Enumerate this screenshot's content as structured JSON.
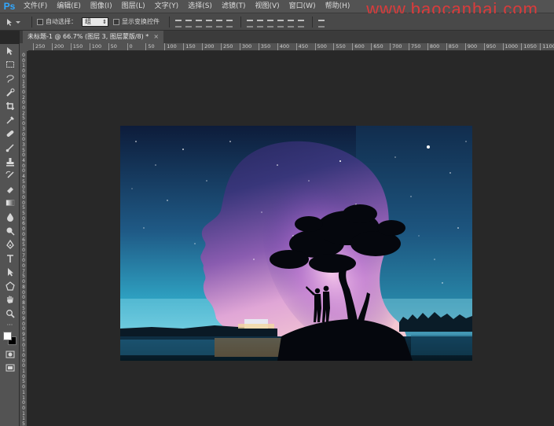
{
  "app": {
    "logo": "Ps"
  },
  "menu": {
    "items": [
      "文件(F)",
      "编辑(E)",
      "图像(I)",
      "图层(L)",
      "文字(Y)",
      "选择(S)",
      "滤镜(T)",
      "视图(V)",
      "窗口(W)",
      "帮助(H)"
    ]
  },
  "watermark": {
    "text": "www.baocanhai.com"
  },
  "options": {
    "auto_select_label": "自动选择：",
    "auto_select_value": "组",
    "show_transform_label": "显示变换控件"
  },
  "document": {
    "tab_title": "未标题-1 @ 66.7% (图层 3, 图层蒙版/8) *",
    "tab_close": "×"
  },
  "rulers": {
    "h_ticks": [
      "250",
      "200",
      "150",
      "100",
      "50",
      "0",
      "50",
      "100",
      "150",
      "200",
      "250",
      "300",
      "350",
      "400",
      "450",
      "500",
      "550",
      "600",
      "650",
      "700",
      "750",
      "800",
      "850",
      "900",
      "950",
      "1000",
      "1050",
      "1100",
      "1150",
      "1200",
      "125"
    ],
    "v_ticks": [
      "0",
      "0",
      "1",
      "0",
      "0",
      "1",
      "5",
      "0",
      "2",
      "0",
      "0",
      "2",
      "5",
      "0",
      "3",
      "0",
      "0",
      "3",
      "5",
      "0",
      "4",
      "0",
      "0",
      "4",
      "5",
      "0",
      "5",
      "0",
      "0",
      "5",
      "5",
      "0",
      "6",
      "0",
      "0",
      "6",
      "5",
      "0",
      "7",
      "0",
      "0",
      "7",
      "5",
      "0",
      "8",
      "0",
      "0",
      "8",
      "5",
      "0",
      "9",
      "0",
      "0",
      "9",
      "5",
      "0",
      "1",
      "0",
      "0",
      "0",
      "1",
      "0",
      "5",
      "0",
      "1",
      "1",
      "0",
      "0",
      "1",
      "1",
      "5"
    ]
  },
  "tools": [
    "move-icon",
    "marquee-icon",
    "lasso-icon",
    "quick-select-icon",
    "crop-icon",
    "eyedropper-icon",
    "healing-icon",
    "brush-icon",
    "stamp-icon",
    "history-brush-icon",
    "eraser-icon",
    "gradient-icon",
    "blur-icon",
    "dodge-icon",
    "pen-icon",
    "type-icon",
    "path-select-icon",
    "shape-icon",
    "hand-icon",
    "zoom-icon"
  ],
  "colors": {
    "foreground": "#ffffff",
    "background": "#000000",
    "panel": "#535353",
    "workspace": "#282828"
  }
}
